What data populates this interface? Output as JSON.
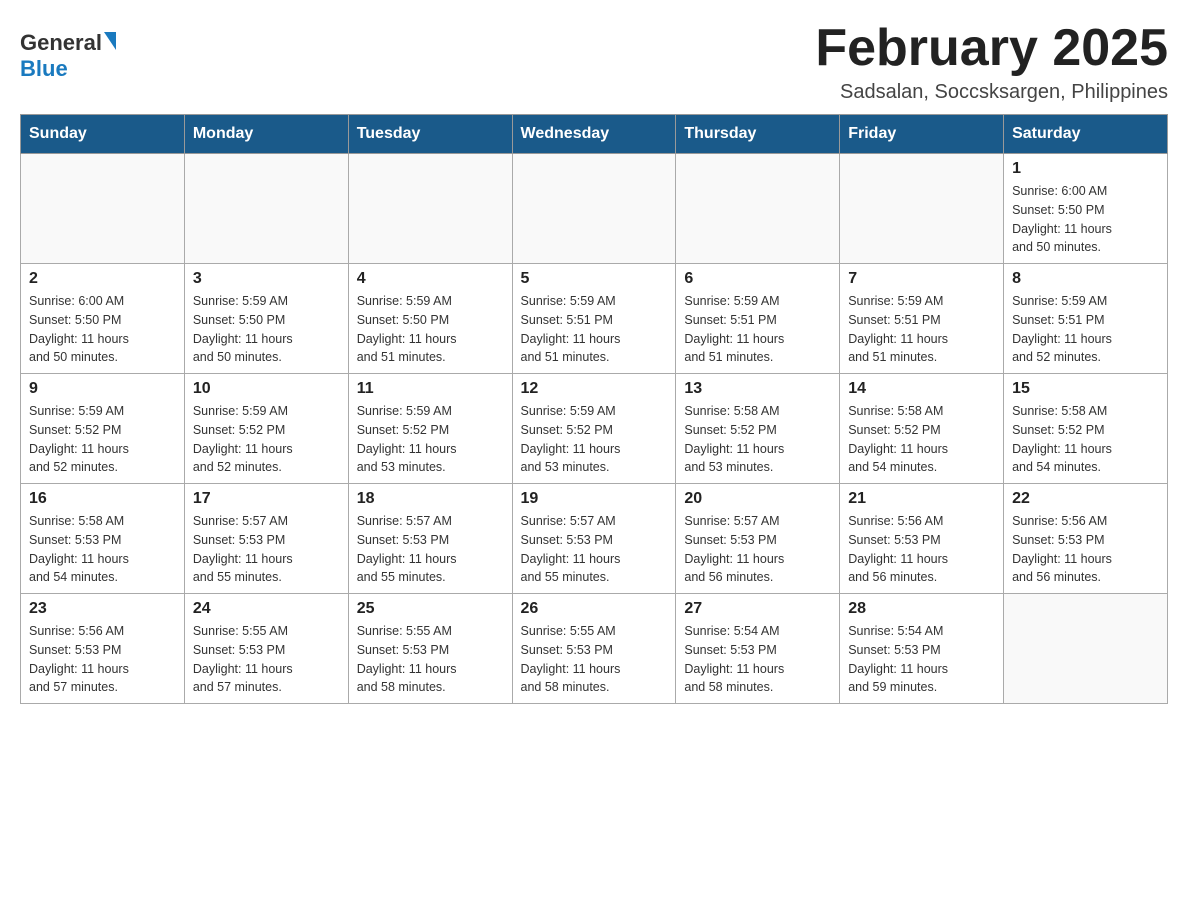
{
  "header": {
    "logo_general": "General",
    "logo_blue": "Blue",
    "title": "February 2025",
    "subtitle": "Sadsalan, Soccsksargen, Philippines"
  },
  "weekdays": [
    "Sunday",
    "Monday",
    "Tuesday",
    "Wednesday",
    "Thursday",
    "Friday",
    "Saturday"
  ],
  "weeks": [
    [
      {
        "day": "",
        "info": ""
      },
      {
        "day": "",
        "info": ""
      },
      {
        "day": "",
        "info": ""
      },
      {
        "day": "",
        "info": ""
      },
      {
        "day": "",
        "info": ""
      },
      {
        "day": "",
        "info": ""
      },
      {
        "day": "1",
        "info": "Sunrise: 6:00 AM\nSunset: 5:50 PM\nDaylight: 11 hours\nand 50 minutes."
      }
    ],
    [
      {
        "day": "2",
        "info": "Sunrise: 6:00 AM\nSunset: 5:50 PM\nDaylight: 11 hours\nand 50 minutes."
      },
      {
        "day": "3",
        "info": "Sunrise: 5:59 AM\nSunset: 5:50 PM\nDaylight: 11 hours\nand 50 minutes."
      },
      {
        "day": "4",
        "info": "Sunrise: 5:59 AM\nSunset: 5:50 PM\nDaylight: 11 hours\nand 51 minutes."
      },
      {
        "day": "5",
        "info": "Sunrise: 5:59 AM\nSunset: 5:51 PM\nDaylight: 11 hours\nand 51 minutes."
      },
      {
        "day": "6",
        "info": "Sunrise: 5:59 AM\nSunset: 5:51 PM\nDaylight: 11 hours\nand 51 minutes."
      },
      {
        "day": "7",
        "info": "Sunrise: 5:59 AM\nSunset: 5:51 PM\nDaylight: 11 hours\nand 51 minutes."
      },
      {
        "day": "8",
        "info": "Sunrise: 5:59 AM\nSunset: 5:51 PM\nDaylight: 11 hours\nand 52 minutes."
      }
    ],
    [
      {
        "day": "9",
        "info": "Sunrise: 5:59 AM\nSunset: 5:52 PM\nDaylight: 11 hours\nand 52 minutes."
      },
      {
        "day": "10",
        "info": "Sunrise: 5:59 AM\nSunset: 5:52 PM\nDaylight: 11 hours\nand 52 minutes."
      },
      {
        "day": "11",
        "info": "Sunrise: 5:59 AM\nSunset: 5:52 PM\nDaylight: 11 hours\nand 53 minutes."
      },
      {
        "day": "12",
        "info": "Sunrise: 5:59 AM\nSunset: 5:52 PM\nDaylight: 11 hours\nand 53 minutes."
      },
      {
        "day": "13",
        "info": "Sunrise: 5:58 AM\nSunset: 5:52 PM\nDaylight: 11 hours\nand 53 minutes."
      },
      {
        "day": "14",
        "info": "Sunrise: 5:58 AM\nSunset: 5:52 PM\nDaylight: 11 hours\nand 54 minutes."
      },
      {
        "day": "15",
        "info": "Sunrise: 5:58 AM\nSunset: 5:52 PM\nDaylight: 11 hours\nand 54 minutes."
      }
    ],
    [
      {
        "day": "16",
        "info": "Sunrise: 5:58 AM\nSunset: 5:53 PM\nDaylight: 11 hours\nand 54 minutes."
      },
      {
        "day": "17",
        "info": "Sunrise: 5:57 AM\nSunset: 5:53 PM\nDaylight: 11 hours\nand 55 minutes."
      },
      {
        "day": "18",
        "info": "Sunrise: 5:57 AM\nSunset: 5:53 PM\nDaylight: 11 hours\nand 55 minutes."
      },
      {
        "day": "19",
        "info": "Sunrise: 5:57 AM\nSunset: 5:53 PM\nDaylight: 11 hours\nand 55 minutes."
      },
      {
        "day": "20",
        "info": "Sunrise: 5:57 AM\nSunset: 5:53 PM\nDaylight: 11 hours\nand 56 minutes."
      },
      {
        "day": "21",
        "info": "Sunrise: 5:56 AM\nSunset: 5:53 PM\nDaylight: 11 hours\nand 56 minutes."
      },
      {
        "day": "22",
        "info": "Sunrise: 5:56 AM\nSunset: 5:53 PM\nDaylight: 11 hours\nand 56 minutes."
      }
    ],
    [
      {
        "day": "23",
        "info": "Sunrise: 5:56 AM\nSunset: 5:53 PM\nDaylight: 11 hours\nand 57 minutes."
      },
      {
        "day": "24",
        "info": "Sunrise: 5:55 AM\nSunset: 5:53 PM\nDaylight: 11 hours\nand 57 minutes."
      },
      {
        "day": "25",
        "info": "Sunrise: 5:55 AM\nSunset: 5:53 PM\nDaylight: 11 hours\nand 58 minutes."
      },
      {
        "day": "26",
        "info": "Sunrise: 5:55 AM\nSunset: 5:53 PM\nDaylight: 11 hours\nand 58 minutes."
      },
      {
        "day": "27",
        "info": "Sunrise: 5:54 AM\nSunset: 5:53 PM\nDaylight: 11 hours\nand 58 minutes."
      },
      {
        "day": "28",
        "info": "Sunrise: 5:54 AM\nSunset: 5:53 PM\nDaylight: 11 hours\nand 59 minutes."
      },
      {
        "day": "",
        "info": ""
      }
    ]
  ]
}
